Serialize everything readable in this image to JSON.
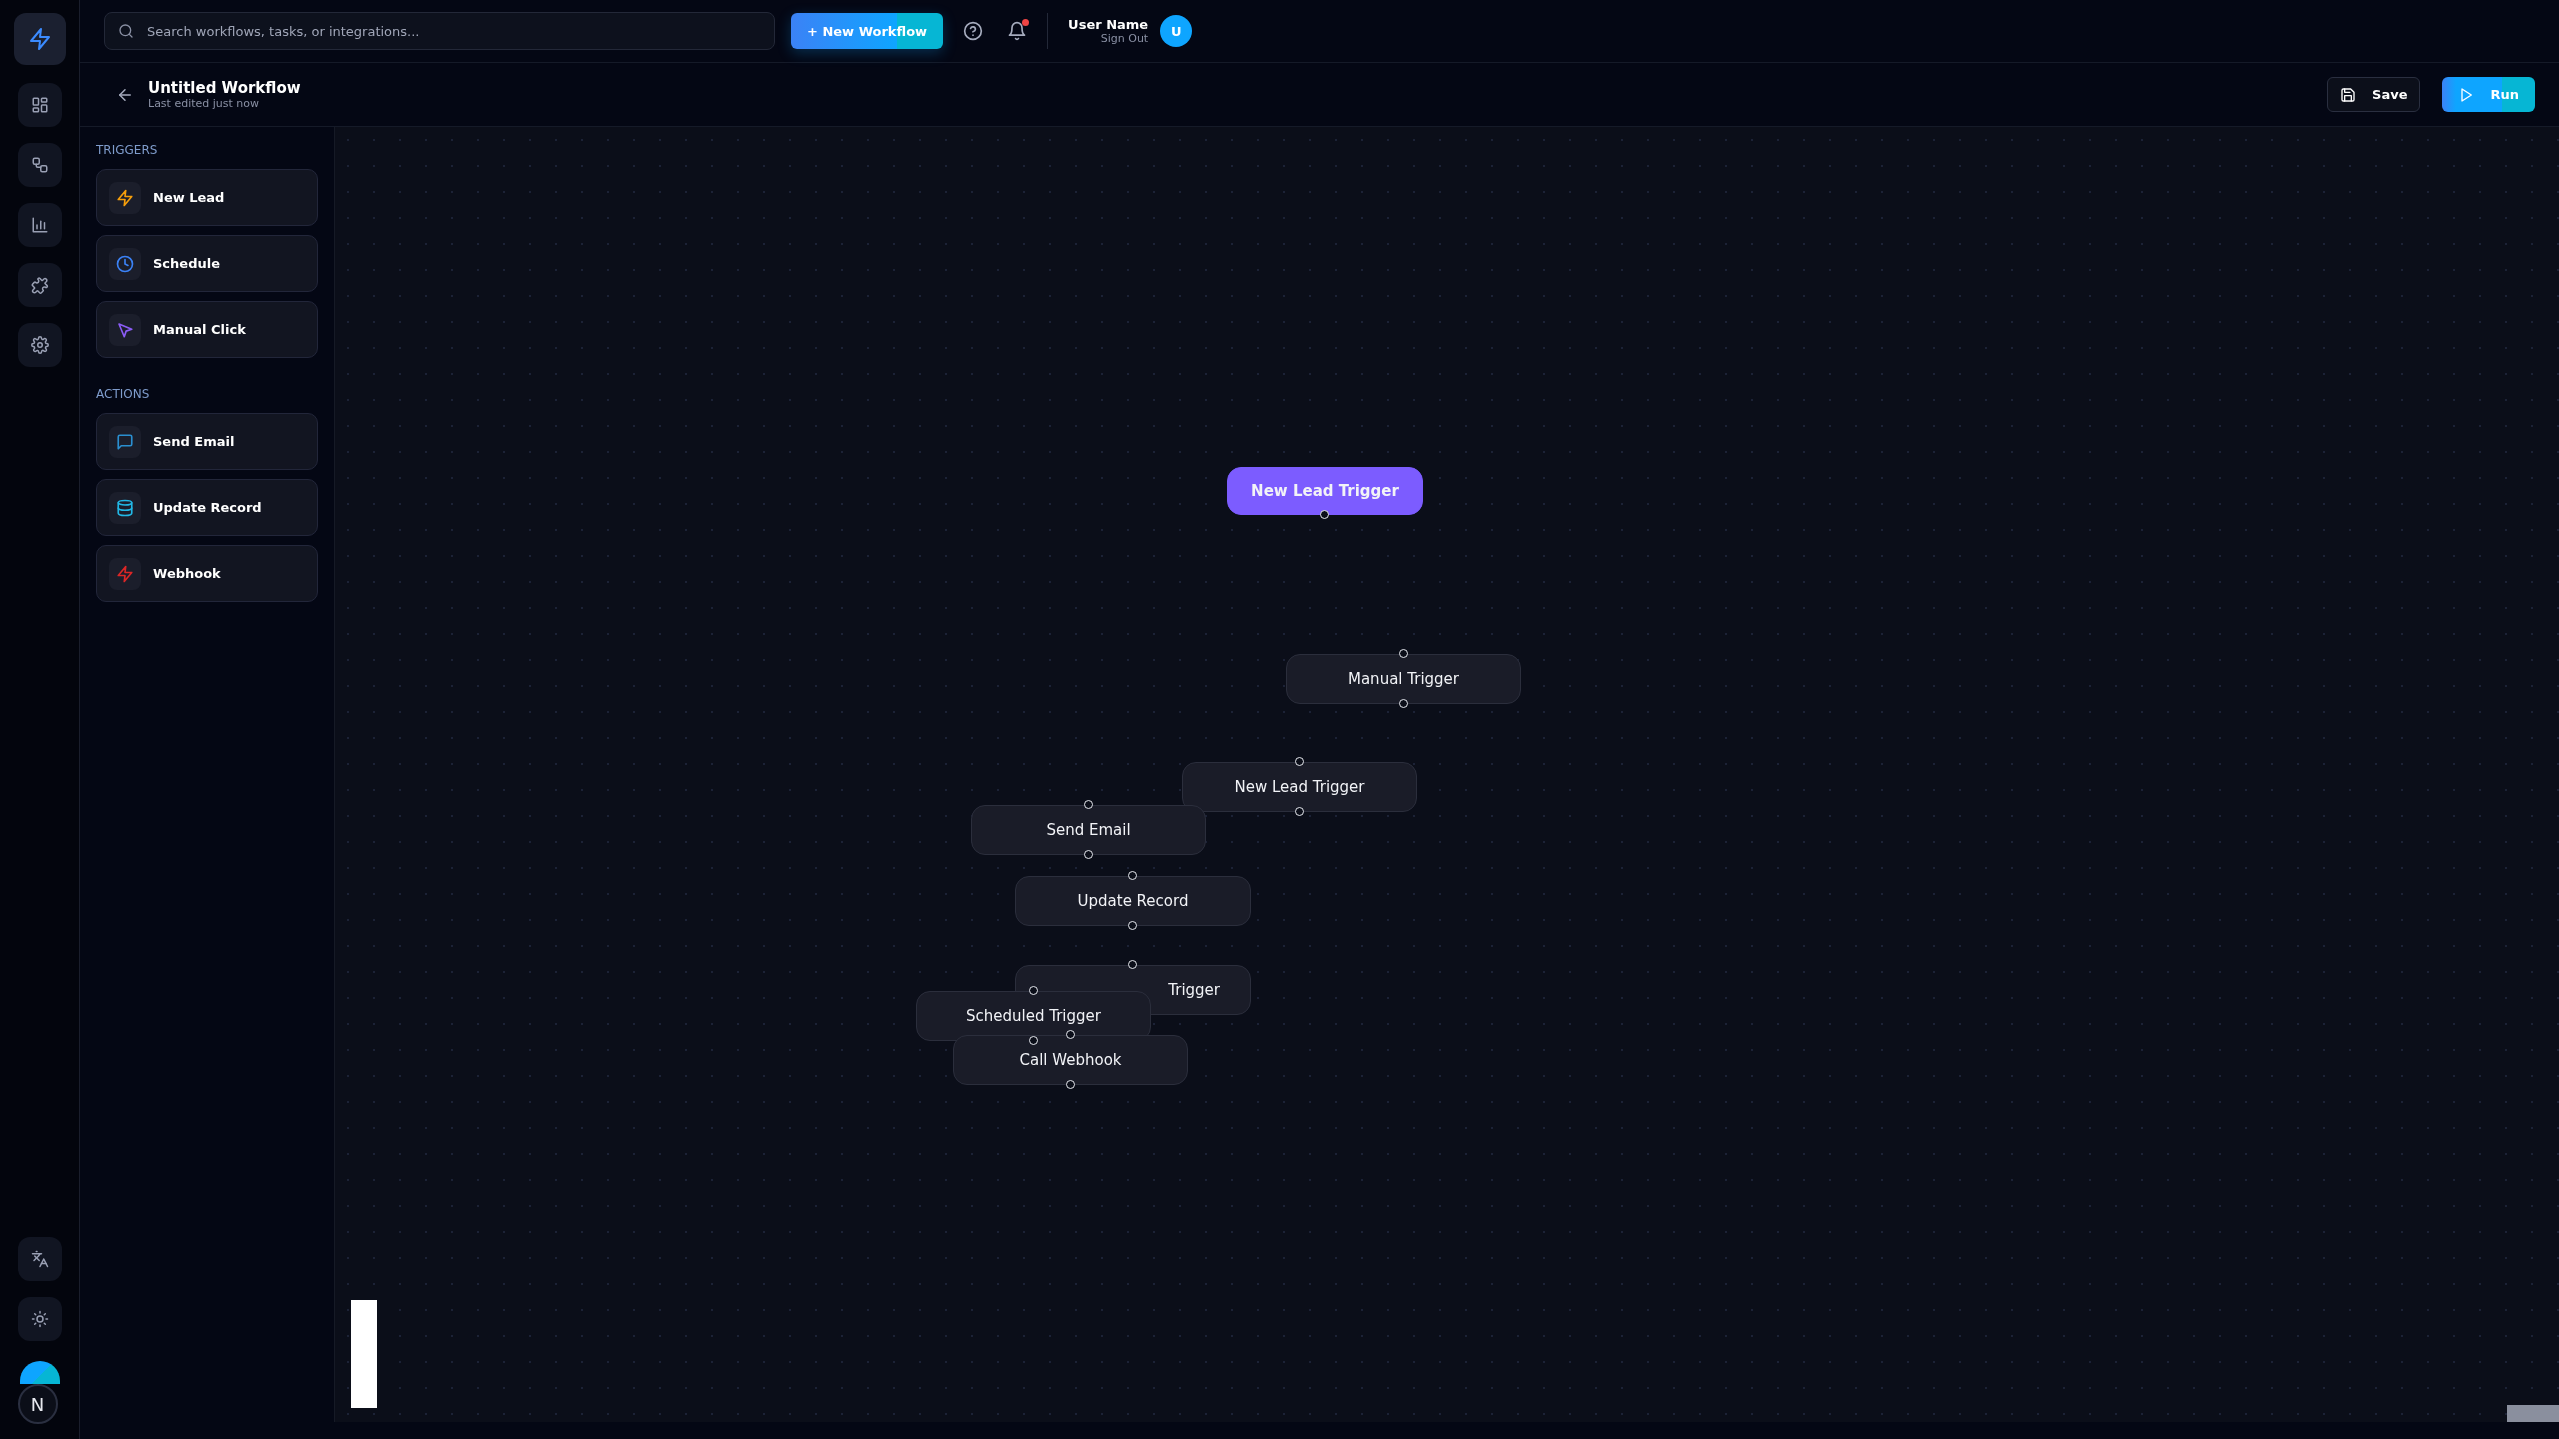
{
  "topbar": {
    "search": {
      "placeholder": "Search workflows, tasks, or integrations..."
    },
    "new_button": "+ New Workflow",
    "notifications": {
      "unread": true
    },
    "user": {
      "name": "User Name",
      "action": "Sign Out",
      "initial": "U"
    }
  },
  "workflow": {
    "title": "Untitled Workflow",
    "subtitle": "Last edited just now",
    "buttons": [
      {
        "label": "Save",
        "kind": "secondary"
      },
      {
        "label": "Run",
        "kind": "primary"
      }
    ]
  },
  "palette": {
    "sections": [
      {
        "title": "TRIGGERS",
        "items": [
          {
            "label": "New Lead",
            "color": "#f59e0b"
          },
          {
            "label": "Schedule",
            "color": "#3b82f6"
          },
          {
            "label": "Manual Click",
            "color": "#8b5cf6"
          }
        ]
      },
      {
        "title": "ACTIONS",
        "items": [
          {
            "label": "Send Email",
            "color": "#2a8fd0"
          },
          {
            "label": "Update Record",
            "color": "#22b8e6"
          },
          {
            "label": "Webhook",
            "color": "#dc2626"
          }
        ]
      }
    ]
  },
  "canvas": {
    "nodes": [
      {
        "label": "New Lead Trigger",
        "kind": "primary"
      },
      {
        "label": "Manual Trigger",
        "kind": "default"
      },
      {
        "label": "New Lead Trigger",
        "kind": "default"
      },
      {
        "label": "Send Email",
        "kind": "default"
      },
      {
        "label": "Update Record",
        "kind": "default"
      },
      {
        "label": "Trigger",
        "kind": "default"
      },
      {
        "label": "Scheduled Trigger",
        "kind": "default"
      },
      {
        "label": "Call Webhook",
        "kind": "default"
      }
    ]
  },
  "rail": {
    "badge": "N"
  }
}
